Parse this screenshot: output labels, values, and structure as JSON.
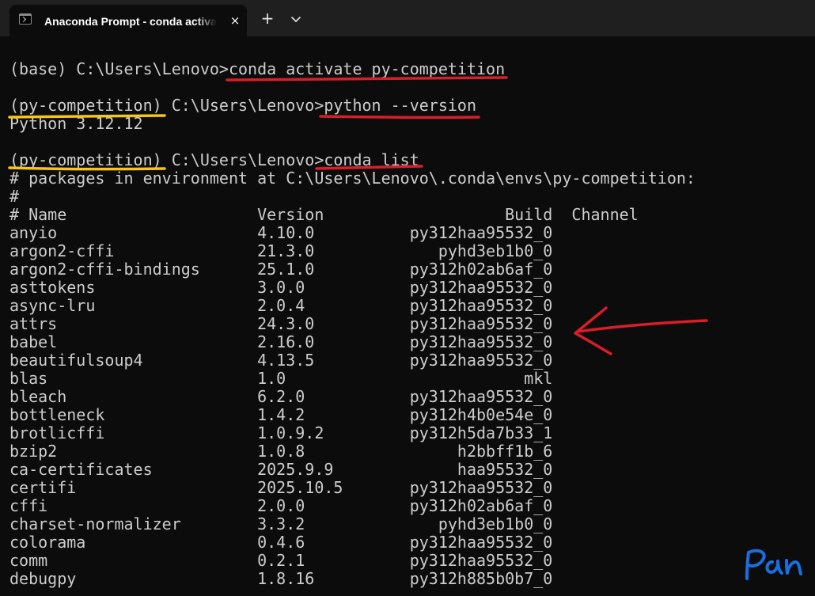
{
  "window": {
    "tab_title": "Anaconda Prompt - conda  activate py-competition",
    "tab_close_label": "×",
    "new_tab_label": "+"
  },
  "terminal": {
    "lines": [
      "(base) C:\\Users\\Lenovo>conda activate py-competition",
      "(py-competition) C:\\Users\\Lenovo>python --version",
      "Python 3.12.12",
      "(py-competition) C:\\Users\\Lenovo>conda list",
      "# packages in environment at C:\\Users\\Lenovo\\.conda\\envs\\py-competition:",
      "#",
      "# Name                    Version                   Build  Channel",
      "anyio                     4.10.0          py312haa95532_0",
      "argon2-cffi               21.3.0             pyhd3eb1b0_0",
      "argon2-cffi-bindings      25.1.0          py312h02ab6af_0",
      "asttokens                 3.0.0           py312haa95532_0",
      "async-lru                 2.0.4           py312haa95532_0",
      "attrs                     24.3.0          py312haa95532_0",
      "babel                     2.16.0          py312haa95532_0",
      "beautifulsoup4            4.13.5          py312haa95532_0",
      "blas                      1.0                         mkl",
      "bleach                    6.2.0           py312haa95532_0",
      "bottleneck                1.4.2           py312h4b0e54e_0",
      "brotlicffi                1.0.9.2         py312h5da7b33_1",
      "bzip2                     1.0.8                h2bbff1b_6",
      "ca-certificates           2025.9.9             haa95532_0",
      "certifi                   2025.10.5       py312haa95532_0",
      "cffi                      2.0.0           py312h02ab6af_0",
      "charset-normalizer        3.3.2              pyhd3eb1b0_0",
      "colorama                  0.4.6           py312haa95532_0",
      "comm                      0.2.1           py312haa95532_0",
      "debugpy                   1.8.16          py312h885b0b7_0"
    ]
  },
  "colors": {
    "terminal_background": "#0c0c0c",
    "terminal_text": "#cccccc",
    "annotation_red": "#d81e2a",
    "annotation_yellow": "#f5c518",
    "signature_blue": "#1a6fe0"
  },
  "icons": {
    "tab_icon": "terminal-icon",
    "dropdown": "chevron-down-icon"
  },
  "signature_text": "Pan"
}
